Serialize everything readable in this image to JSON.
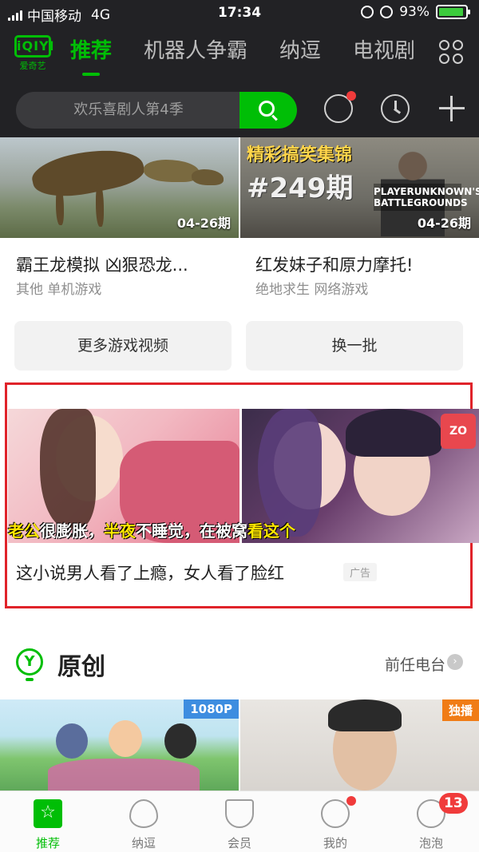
{
  "status_bar": {
    "carrier": "中国移动",
    "network": "4G",
    "time": "17:34",
    "battery_pct": "93%",
    "battery_level": 0.93
  },
  "top_nav": {
    "logo_text": "iQIYI",
    "logo_sub": "爱奇艺",
    "tabs": [
      {
        "label": "推荐",
        "active": true
      },
      {
        "label": "机器人争霸",
        "active": false
      },
      {
        "label": "纳逗",
        "active": false
      },
      {
        "label": "电视剧",
        "active": false
      }
    ],
    "more_icon": "grid-icon"
  },
  "search": {
    "placeholder": "欢乐喜剧人第4季",
    "button_icon": "search-icon"
  },
  "actions": {
    "message_icon": "chat-icon",
    "history_icon": "history-icon",
    "add_icon": "plus-icon"
  },
  "videos": [
    {
      "title": "霸王龙模拟 凶狠恐龙...",
      "tags": "其他 单机游戏",
      "badge": "04-26期"
    },
    {
      "title": "红发妹子和原力摩托!",
      "tags": "绝地求生 网络游戏",
      "badge": "04-26期",
      "overlay_title": "精彩搞笑集锦",
      "overlay_episode": "#249期",
      "overlay_logo": "PLAYERUNKNOWN'S BATTLEGROUNDS"
    }
  ],
  "buttons": {
    "more_games": "更多游戏视频",
    "refresh": "换一批"
  },
  "ad": {
    "caption_parts": [
      "老公",
      "很膨胀，",
      "半夜",
      "不睡觉，",
      "在",
      "被窝",
      "看这个"
    ],
    "book_badge": "ZO",
    "text": "这小说男人看了上瘾，女人看了脸红",
    "tag": "广告"
  },
  "section": {
    "icon_letter": "Y",
    "title": "原创",
    "more": "前任电台",
    "chevron": "›"
  },
  "originals": [
    {
      "badge": "1080P",
      "badge_color": "#3d8de0"
    },
    {
      "badge": "独播",
      "badge_color": "#f07c16"
    }
  ],
  "tabbar": {
    "items": [
      {
        "label": "推荐",
        "icon": "star-icon",
        "active": true
      },
      {
        "label": "纳逗",
        "icon": "flame-icon",
        "active": false
      },
      {
        "label": "会员",
        "icon": "crown-icon",
        "active": false
      },
      {
        "label": "我的",
        "icon": "user-icon",
        "active": false
      },
      {
        "label": "泡泡",
        "icon": "bubble-face-icon",
        "active": false,
        "count": "13"
      }
    ]
  },
  "colors": {
    "brand_green": "#00be06",
    "header_bg": "#222225",
    "ad_border": "#e0232a",
    "badge_red": "#f03b3b"
  }
}
